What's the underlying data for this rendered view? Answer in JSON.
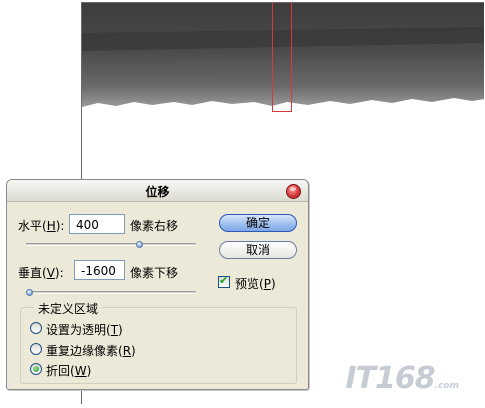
{
  "dialog": {
    "title": "位移",
    "horizontal": {
      "label_prefix": "水平(",
      "mnemonic": "H",
      "label_suffix": "):",
      "value": "400",
      "unit": "像素右移",
      "slider_fraction": 0.68
    },
    "vertical": {
      "label_prefix": "垂直(",
      "mnemonic": "V",
      "label_suffix": "):",
      "value": "-1600",
      "unit": "像素下移",
      "slider_fraction": 0.0
    },
    "ok_label": "确定",
    "cancel_label": "取消",
    "preview": {
      "label_prefix": "预览(",
      "mnemonic": "P",
      "label_suffix": ")",
      "checked": true
    },
    "undefined_area": {
      "title": "未定义区域",
      "options": [
        {
          "prefix": "设置为透明(",
          "mnemonic": "T",
          "suffix": ")",
          "selected": false
        },
        {
          "prefix": "重复边缘像素(",
          "mnemonic": "R",
          "suffix": ")",
          "selected": false
        },
        {
          "prefix": "折回(",
          "mnemonic": "W",
          "suffix": ")",
          "selected": true
        }
      ]
    }
  },
  "watermark": {
    "brand": "IT168",
    "suffix": ".com"
  },
  "colors": {
    "accent": "#3a6fd8",
    "close": "#d83a3a",
    "selection": "#d43a3a"
  }
}
